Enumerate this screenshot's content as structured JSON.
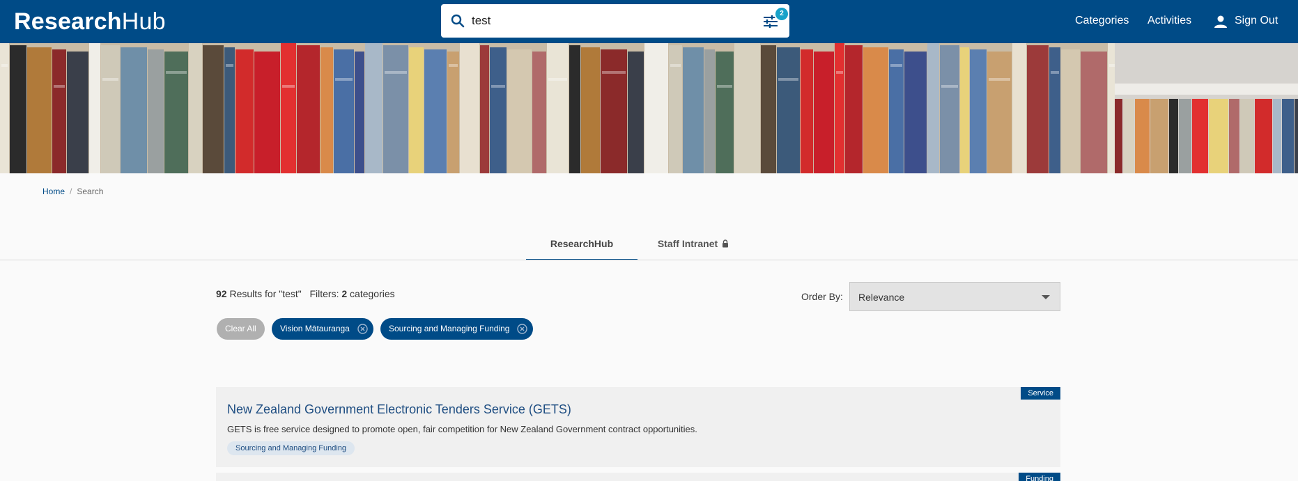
{
  "header": {
    "logo_bold": "Research",
    "logo_light": "Hub",
    "search_value": "test",
    "filter_badge_count": "2",
    "nav": {
      "categories": "Categories",
      "activities": "Activities",
      "sign_out": "Sign Out"
    }
  },
  "breadcrumb": {
    "home": "Home",
    "current": "Search"
  },
  "tabs": [
    {
      "label": "ResearchHub",
      "active": true
    },
    {
      "label": "Staff Intranet",
      "active": false,
      "locked": true
    }
  ],
  "results": {
    "count": "92",
    "results_for_text": " Results for \"test\"",
    "filters_label": "Filters: ",
    "filters_count": "2",
    "filters_suffix": " categories"
  },
  "order_by": {
    "label": "Order By:",
    "selected": "Relevance"
  },
  "chips": {
    "clear_all": "Clear All",
    "filters": [
      "Vision Mātauranga",
      "Sourcing and Managing Funding"
    ]
  },
  "cards": [
    {
      "type": "Service",
      "title": "New Zealand Government Electronic Tenders Service (GETS)",
      "description": "GETS is free service designed to promote open, fair competition for New Zealand Government contract opportunities.",
      "category": "Sourcing and Managing Funding"
    },
    {
      "type": "Funding",
      "title": "",
      "description": "",
      "category": ""
    }
  ],
  "colors": {
    "brand": "#004b87",
    "badge": "#17a2c9",
    "card_bg": "#f0f0f0"
  }
}
